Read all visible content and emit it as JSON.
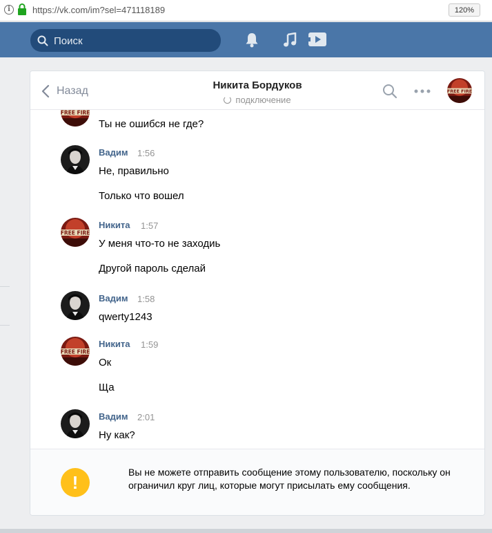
{
  "browser": {
    "url": "https://vk.com/im?sel=471118189",
    "zoom": "120%"
  },
  "header": {
    "search_placeholder": "Поиск",
    "icons": [
      "search-icon",
      "bell-icon",
      "music-icon",
      "video-icon"
    ]
  },
  "chat": {
    "back_label": "Назад",
    "peer_name": "Никита Бордуков",
    "peer_status": "подключение",
    "messages": [
      {
        "sender": "",
        "time": "",
        "lines": [
          "Ты не ошибся не где?"
        ],
        "avatar": "nikita"
      },
      {
        "sender": "Вадим",
        "time": "1:56",
        "lines": [
          "Не, правильно",
          "Только что вошел"
        ],
        "avatar": "vadim"
      },
      {
        "sender": "Никита",
        "time": "1:57",
        "lines": [
          "У меня что-то не заходиь",
          "Другой пароль сделай"
        ],
        "avatar": "nikita"
      },
      {
        "sender": "Вадим",
        "time": "1:58",
        "lines": [
          "qwerty1243"
        ],
        "avatar": "vadim"
      },
      {
        "sender": "Никита",
        "time": "1:59",
        "lines": [
          "Ок",
          "Ща"
        ],
        "avatar": "nikita"
      },
      {
        "sender": "Вадим",
        "time": "2:01",
        "lines": [
          "Ну как?"
        ],
        "avatar": "vadim"
      }
    ]
  },
  "notice": {
    "text": "Вы не можете отправить сообщение этому пользователю, поскольку он ограничил круг лиц, которые могут присылать ему сообщения.",
    "icon": "!"
  },
  "colors": {
    "header_bg": "#4a76a8",
    "sender_name": "#42648b",
    "warning": "#ffc01a"
  }
}
